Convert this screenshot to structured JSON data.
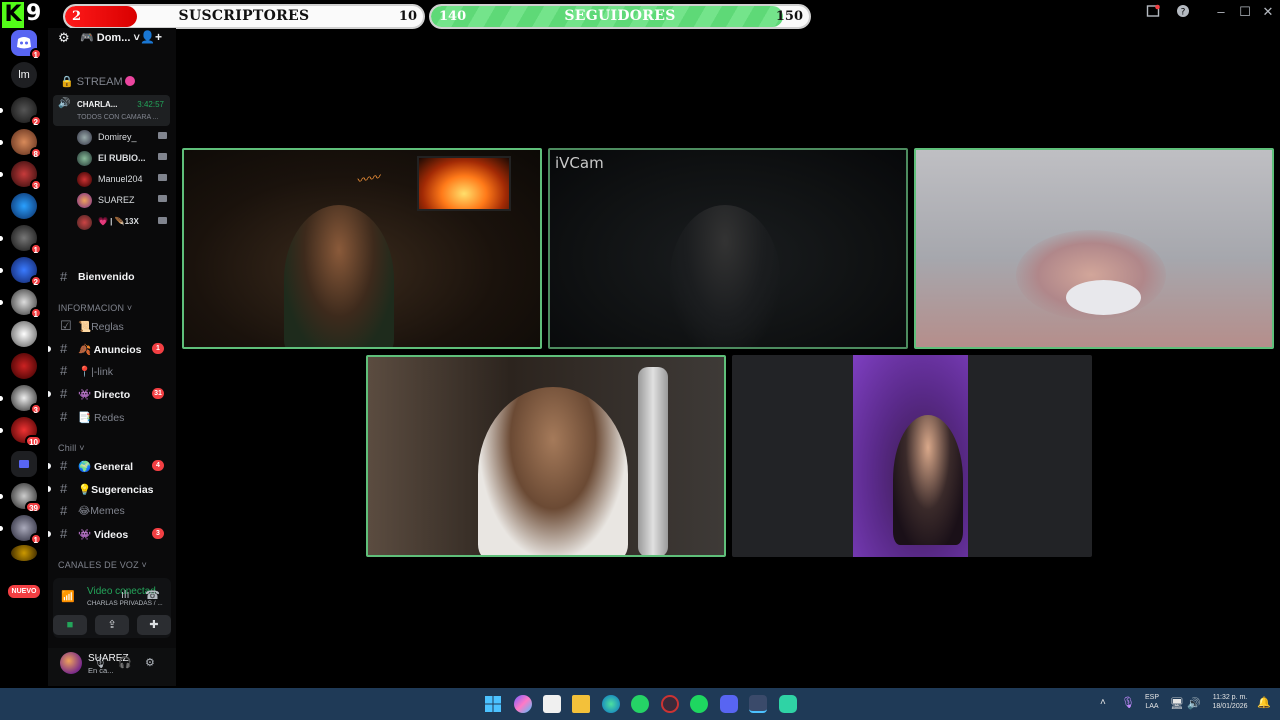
{
  "overlay": {
    "kick_count": "9",
    "subscribers": {
      "label": "SUSCRIPTORES",
      "current": "2",
      "goal": "10",
      "progress": 0.2
    },
    "followers": {
      "label": "SEGUIDORES",
      "current": "140",
      "goal": "150",
      "progress": 0.93
    }
  },
  "server_list": {
    "items": [
      {
        "name": "discord-home",
        "badge": "1"
      },
      {
        "name": "lm-server",
        "badge": "",
        "initials": "lm"
      },
      {
        "name": "server-3",
        "badge": "2"
      },
      {
        "name": "server-4",
        "badge": "8"
      },
      {
        "name": "server-5",
        "badge": "3"
      },
      {
        "name": "server-6",
        "badge": ""
      },
      {
        "name": "server-7",
        "badge": "1"
      },
      {
        "name": "server-8",
        "badge": "2"
      },
      {
        "name": "server-9",
        "badge": "1"
      },
      {
        "name": "server-10",
        "badge": ""
      },
      {
        "name": "server-11",
        "badge": ""
      },
      {
        "name": "server-12",
        "badge": "3"
      },
      {
        "name": "server-13",
        "badge": "10"
      },
      {
        "name": "server-14",
        "badge": ""
      },
      {
        "name": "server-15",
        "badge": "39"
      },
      {
        "name": "server-16",
        "badge": "1"
      },
      {
        "name": "server-17",
        "badge": ""
      }
    ],
    "new_label": "NUEVO"
  },
  "server": {
    "name": "Dom..."
  },
  "stream_channel": {
    "label": "STREAM"
  },
  "active_voice": {
    "name": "CHARLA...",
    "time": "3:42:57",
    "status": "TODOS CON CAMARA ..."
  },
  "voice_users": [
    {
      "name": "Domirey_"
    },
    {
      "name": "El RUBIO..."
    },
    {
      "name": "Manuel204"
    },
    {
      "name": "SUAREZ"
    },
    {
      "name": "💗 | 🪶13X"
    }
  ],
  "channels": {
    "bienvenido": "Bienvenido",
    "cat_info": "INFORMACION",
    "reglas": "📜Reglas",
    "anuncios": "Anuncios",
    "anuncios_badge": "1",
    "link": "📍|-link",
    "directo": "Directo",
    "directo_badge": "31",
    "redes": "Redes",
    "cat_chill": "Chill",
    "general": "General",
    "general_badge": "4",
    "sugerencias": "💡Sugerencias",
    "memes": "😂Memes",
    "videos": "Videos",
    "videos_badge": "3",
    "cat_voz": "CANALES DE VOZ"
  },
  "voice_panel": {
    "title": "Video conectad",
    "subtitle": "CHARLAS PRIVADAS / ..."
  },
  "user_panel": {
    "name": "SUAREZ",
    "status": "En ca..."
  },
  "video_tiles": [
    {
      "id": "tile-1",
      "speaking": true
    },
    {
      "id": "tile-2",
      "label": "iVCam"
    },
    {
      "id": "tile-3"
    },
    {
      "id": "tile-4"
    },
    {
      "id": "tile-5"
    }
  ],
  "taskbar": {
    "language": "ESP",
    "layout": "LAA",
    "time": "11:32 p. m.",
    "date": "18/01/2026"
  }
}
